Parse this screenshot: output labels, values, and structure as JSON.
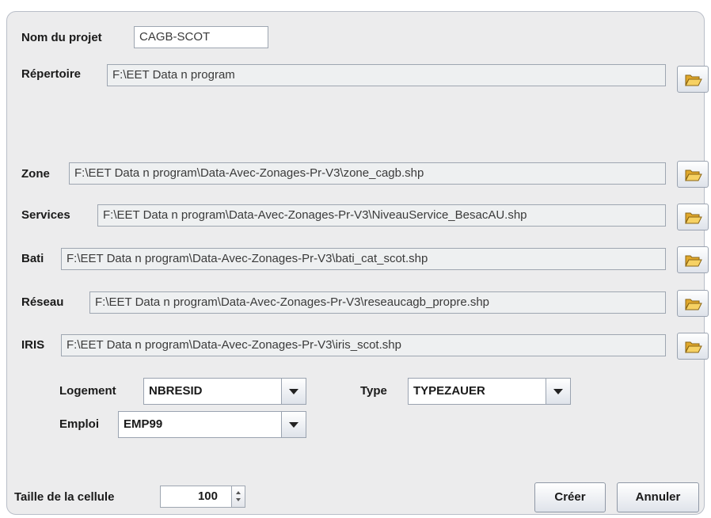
{
  "project": {
    "label": "Nom du projet",
    "value": "CAGB-SCOT"
  },
  "directory": {
    "label": "Répertoire",
    "value": "F:\\EET Data n program"
  },
  "files": [
    {
      "label": "Zone",
      "value": "F:\\EET Data n program\\Data-Avec-Zonages-Pr-V3\\zone_cagb.shp"
    },
    {
      "label": "Services",
      "value": "F:\\EET Data n program\\Data-Avec-Zonages-Pr-V3\\NiveauService_BesacAU.shp"
    },
    {
      "label": "Bati",
      "value": "F:\\EET Data n program\\Data-Avec-Zonages-Pr-V3\\bati_cat_scot.shp"
    },
    {
      "label": "Réseau",
      "value": "F:\\EET Data n program\\Data-Avec-Zonages-Pr-V3\\reseaucagb_propre.shp"
    },
    {
      "label": "IRIS",
      "value": "F:\\EET Data n program\\Data-Avec-Zonages-Pr-V3\\iris_scot.shp"
    }
  ],
  "selects": {
    "logement": {
      "label": "Logement",
      "value": "NBRESID"
    },
    "type": {
      "label": "Type",
      "value": "TYPEZAUER"
    },
    "emploi": {
      "label": "Emploi",
      "value": "EMP99"
    }
  },
  "cell_size": {
    "label": "Taille de la cellule",
    "value": "100"
  },
  "buttons": {
    "create": "Créer",
    "cancel": "Annuler"
  },
  "icons": {
    "browse": "folder-open-icon",
    "dropdown": "chevron-down-icon"
  },
  "colors": {
    "panel_bg": "#ececed",
    "field_bg": "#eef0f1",
    "folder": "#f2c24a"
  }
}
